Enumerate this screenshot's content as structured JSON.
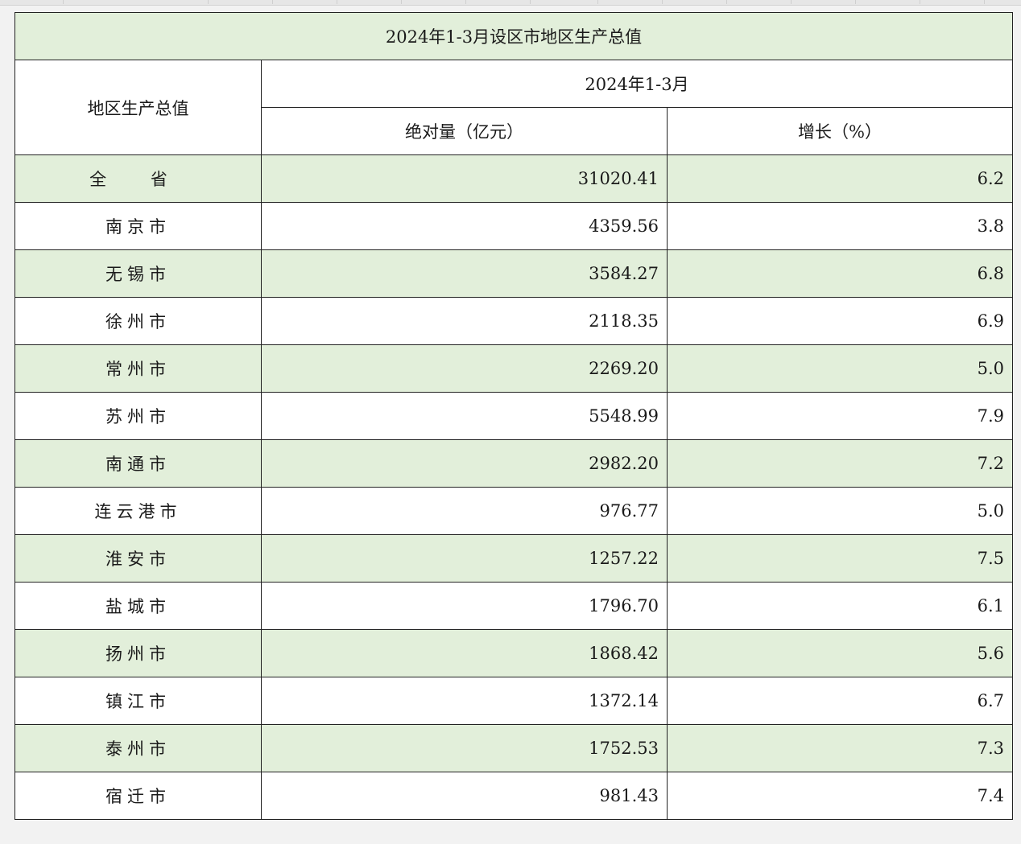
{
  "table": {
    "title": "2024年1-3月设区市地区生产总值",
    "row_header": "地区生产总值",
    "period": "2024年1-3月",
    "col_abs": "绝对量（亿元）",
    "col_growth": "增长（%）",
    "rows": [
      {
        "region": "全 省",
        "abs": "31020.41",
        "growth": "6.2"
      },
      {
        "region": "南京市",
        "abs": "4359.56",
        "growth": "3.8"
      },
      {
        "region": "无锡市",
        "abs": "3584.27",
        "growth": "6.8"
      },
      {
        "region": "徐州市",
        "abs": "2118.35",
        "growth": "6.9"
      },
      {
        "region": "常州市",
        "abs": "2269.20",
        "growth": "5.0"
      },
      {
        "region": "苏州市",
        "abs": "5548.99",
        "growth": "7.9"
      },
      {
        "region": "南通市",
        "abs": "2982.20",
        "growth": "7.2"
      },
      {
        "region": "连云港市",
        "abs": "976.77",
        "growth": "5.0"
      },
      {
        "region": "淮安市",
        "abs": "1257.22",
        "growth": "7.5"
      },
      {
        "region": "盐城市",
        "abs": "1796.70",
        "growth": "6.1"
      },
      {
        "region": "扬州市",
        "abs": "1868.42",
        "growth": "5.6"
      },
      {
        "region": "镇江市",
        "abs": "1372.14",
        "growth": "6.7"
      },
      {
        "region": "泰州市",
        "abs": "1752.53",
        "growth": "7.3"
      },
      {
        "region": "宿迁市",
        "abs": "981.43",
        "growth": "7.4"
      }
    ]
  }
}
